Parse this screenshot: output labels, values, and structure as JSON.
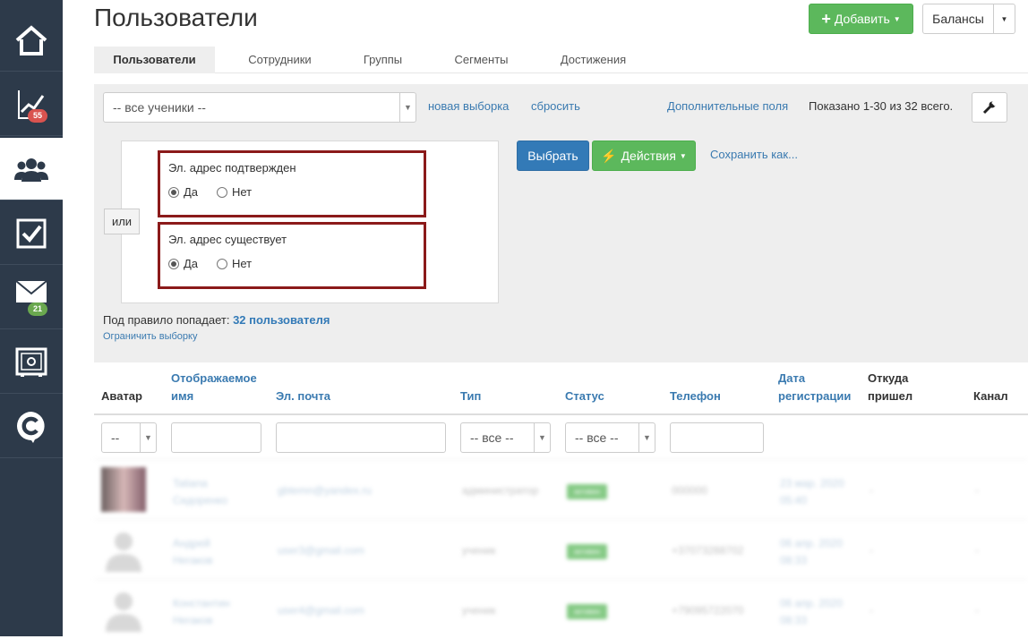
{
  "sidebar": {
    "items": [
      {
        "icon": "home-icon"
      },
      {
        "icon": "chart-icon",
        "badge": "55",
        "badge_color": "#d9534f"
      },
      {
        "icon": "users-icon"
      },
      {
        "icon": "checkbox-icon"
      },
      {
        "icon": "mail-icon",
        "badge": "21",
        "badge_color": "#6aa84f"
      },
      {
        "icon": "safe-icon"
      },
      {
        "icon": "logo-c-icon"
      }
    ]
  },
  "header": {
    "title": "Пользователи",
    "add_label": "Добавить",
    "balances_label": "Балансы"
  },
  "tabs": [
    "Пользователи",
    "Сотрудники",
    "Группы",
    "Сегменты",
    "Достижения"
  ],
  "filter": {
    "select_value": "-- все ученики --",
    "new_selection": "новая выборка",
    "reset": "сбросить",
    "extra_fields": "Дополнительные поля",
    "shown": "Показано 1-30 из 32 всего.",
    "choose": "Выбрать",
    "actions": "Действия",
    "save_as": "Сохранить как...",
    "or_label": "или",
    "conditions": [
      {
        "label": "Эл. адрес подтвержден",
        "yes": "Да",
        "no": "Нет",
        "selected": "yes"
      },
      {
        "label": "Эл. адрес существует",
        "yes": "Да",
        "no": "Нет",
        "selected": "yes"
      }
    ],
    "rule_text": "Под правило попадает:",
    "rule_count": "32 пользователя",
    "limit": "Ограничить выборку"
  },
  "table": {
    "headers": {
      "avatar": "Аватар",
      "name_1": "Отображаемое",
      "name_2": "имя",
      "email": "Эл. почта",
      "type": "Тип",
      "status": "Статус",
      "phone": "Телефон",
      "reg_1": "Дата",
      "reg_2": "регистрации",
      "src_1": "Откуда",
      "src_2": "пришел",
      "channel": "Канал"
    },
    "filters": {
      "avatar_select": "--",
      "type_select": "-- все --",
      "status_select": "-- все --"
    },
    "rows": [
      {
        "name_1": "Tatiana",
        "name_2": "Сидоренко",
        "email": "gbtemn@yandex.ru",
        "type": "администратор",
        "status": "активен",
        "phone": "000000",
        "date_1": "23 мар. 2020",
        "date_2": "05:40",
        "src": "-",
        "channel": "-"
      },
      {
        "name_1": "Андрей",
        "name_2": "Негаков",
        "email": "user3@gmail.com",
        "type": "ученик",
        "status": "активен",
        "phone": "+37073288702",
        "date_1": "06 апр. 2020",
        "date_2": "08:33",
        "src": "-",
        "channel": "-"
      },
      {
        "name_1": "Константин",
        "name_2": "Негаков",
        "email": "user4@gmail.com",
        "type": "ученик",
        "status": "активен",
        "phone": "+79095722070",
        "date_1": "06 апр. 2020",
        "date_2": "08:33",
        "src": "-",
        "channel": "-"
      }
    ]
  }
}
